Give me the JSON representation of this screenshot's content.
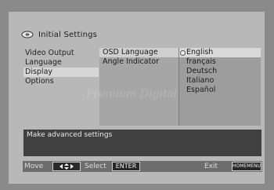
{
  "title": "Initial Settings",
  "icons": {
    "title_icon": "disc-icon",
    "arrows_icon": "arrows-icon"
  },
  "menu": {
    "items": [
      {
        "label": "Video Output",
        "selected": false
      },
      {
        "label": "Language",
        "selected": false
      },
      {
        "label": "Display",
        "selected": true
      },
      {
        "label": "Options",
        "selected": false
      }
    ]
  },
  "submenu": {
    "items": [
      {
        "label": "OSD Language",
        "selected": true
      },
      {
        "label": "Angle Indicator",
        "selected": false
      }
    ]
  },
  "options": {
    "items": [
      {
        "label": "English",
        "selected": true
      },
      {
        "label": "français",
        "selected": false
      },
      {
        "label": "Deutsch",
        "selected": false
      },
      {
        "label": "Italiano",
        "selected": false
      },
      {
        "label": "Español",
        "selected": false
      }
    ]
  },
  "watermark": "Premium Digital",
  "help_text": "Make advanced settings",
  "footer": {
    "move_label": "Move",
    "select_label": "Select",
    "enter_key": "ENTER",
    "exit_label": "Exit",
    "homemenu_key": "HOMEMENU"
  }
}
